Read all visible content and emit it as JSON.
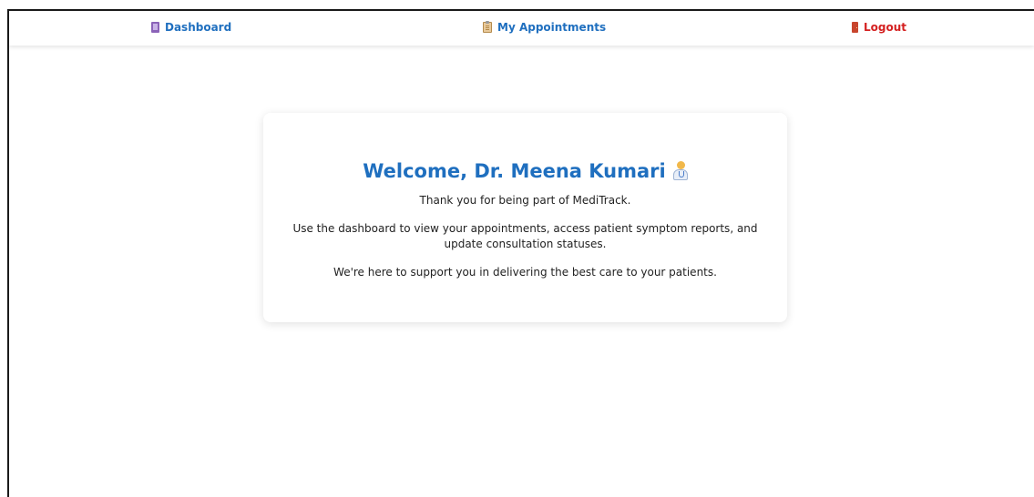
{
  "nav": {
    "dashboard": {
      "label": "Dashboard",
      "icon": "book-icon"
    },
    "appointments": {
      "label": "My Appointments",
      "icon": "clipboard-icon"
    },
    "logout": {
      "label": "Logout",
      "icon": "door-icon"
    }
  },
  "card": {
    "title": "Welcome, Dr. Meena Kumari",
    "title_icon": "doctor-icon",
    "line1": "Thank you for being part of MediTrack.",
    "line2a": "Use the dashboard to view your appointments, access patient symptom reports, and",
    "line2b": "update consultation statuses.",
    "line3": "We're here to support you in delivering the best care to your patients."
  },
  "colors": {
    "accent": "#1f6fbf",
    "logout": "#d42020",
    "text": "#222222",
    "background": "#ffffff"
  }
}
